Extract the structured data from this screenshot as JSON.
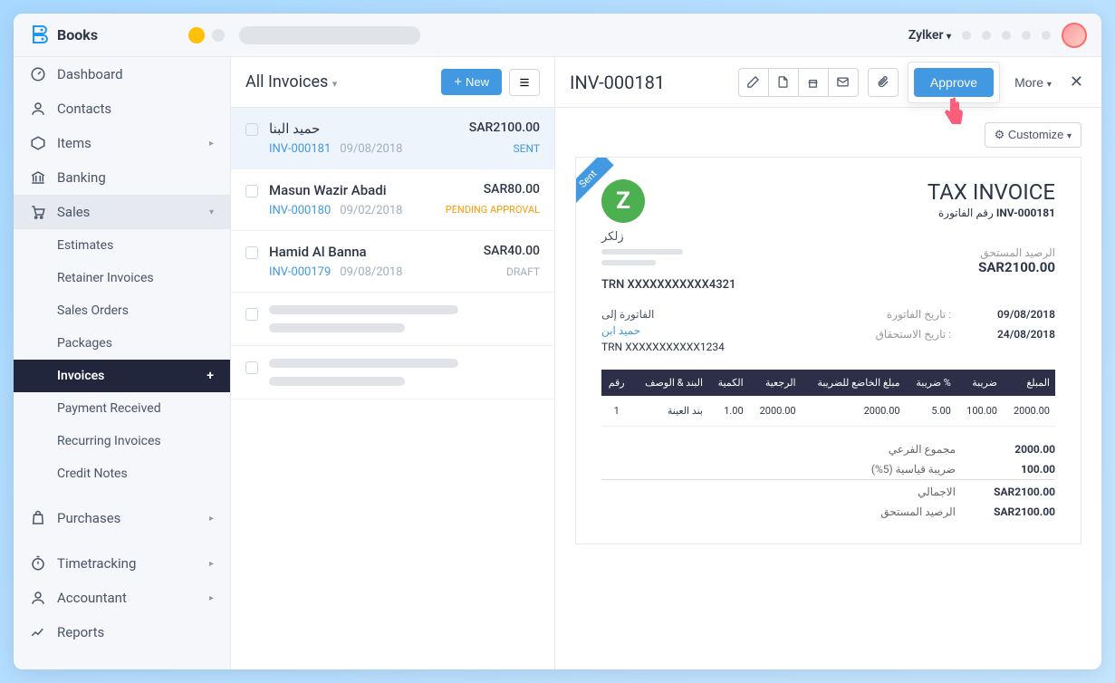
{
  "app_name": "Books",
  "org_name": "Zylker",
  "sidebar": {
    "items": [
      {
        "label": "Dashboard",
        "icon": "gauge"
      },
      {
        "label": "Contacts",
        "icon": "user"
      },
      {
        "label": "Items",
        "icon": "tag",
        "arrow": true
      },
      {
        "label": "Banking",
        "icon": "bank"
      },
      {
        "label": "Sales",
        "icon": "cart",
        "arrow": true,
        "open": true
      },
      {
        "label": "Purchases",
        "icon": "bag",
        "arrow": true
      },
      {
        "label": "Timetracking",
        "icon": "timer",
        "arrow": true
      },
      {
        "label": "Accountant",
        "icon": "person",
        "arrow": true
      },
      {
        "label": "Reports",
        "icon": "chart"
      }
    ],
    "sales_sub": [
      "Estimates",
      "Retainer Invoices",
      "Sales Orders",
      "Packages",
      "Invoices",
      "Payment Received",
      "Recurring Invoices",
      "Credit Notes"
    ]
  },
  "list": {
    "title": "All Invoices",
    "new_label": "New",
    "rows": [
      {
        "name": "حميد البنا",
        "amount": "SAR2100.00",
        "num": "INV-000181",
        "date": "09/08/2018",
        "status": "SENT",
        "status_cls": "stat-sent",
        "selected": true
      },
      {
        "name": "Masun Wazir Abadi",
        "amount": "SAR80.00",
        "num": "INV-000180",
        "date": "09/02/2018",
        "status": "PENDING APPROVAL",
        "status_cls": "stat-pending"
      },
      {
        "name": "Hamid Al Banna",
        "amount": "SAR40.00",
        "num": "INV-000179",
        "date": "09/08/2018",
        "status": "DRAFT",
        "status_cls": "stat-draft"
      }
    ]
  },
  "detail": {
    "title": "INV-000181",
    "approve_label": "Approve",
    "more_label": "More",
    "customize_label": "Customize",
    "ribbon": "Sent"
  },
  "invoice": {
    "title": "TAX INVOICE",
    "num_label": "رقم الفاتورة",
    "num": "INV-000181",
    "org": "زلكر",
    "trn": "TRN XXXXXXXXXXX4321",
    "due_label": "الرصيد المستحق",
    "due_amount": "SAR2100.00",
    "bill_to_label": "الفاتورة إلى",
    "bill_to_name": "حميد ابن",
    "bill_to_trn": "TRN XXXXXXXXXXX1234",
    "date_label": "تاريخ الفاتورة :",
    "date_val": "09/08/2018",
    "due_date_label": "تاريخ الاستحقاق :",
    "due_date_val": "24/08/2018",
    "headers": [
      "رقم",
      "البند & الوصف",
      "الكمية",
      "الرجعية",
      "مبلغ الخاضع للضريبة",
      "ضريبة %",
      "ضريبة",
      "المبلغ"
    ],
    "line": {
      "idx": "1",
      "desc": "بند العينة",
      "qty": "1.00",
      "rate": "2000.00",
      "taxable": "2000.00",
      "taxpct": "5.00",
      "tax": "100.00",
      "amount": "2000.00"
    },
    "subtotal_label": "مجموع الفرعي",
    "subtotal": "2000.00",
    "vat_label": "ضريبة قياسية (5%)",
    "vat": "100.00",
    "total_label": "الاجمالي",
    "total": "SAR2100.00",
    "balance_label": "الرصيد المستحق",
    "balance": "SAR2100.00"
  }
}
